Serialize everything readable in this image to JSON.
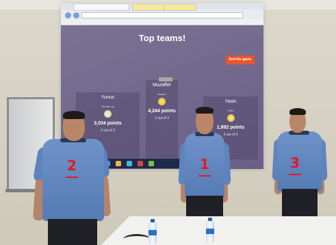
{
  "screen": {
    "title": "Top teams!",
    "end_button": "End the game",
    "url": "",
    "teams": [
      {
        "rank_number": "1",
        "name": "Muzaffer",
        "points": "4,244 points",
        "rank_text": "1 out of 3",
        "label": "Winner"
      },
      {
        "rank_number": "2",
        "name": "Yunus",
        "points": "3,034 points",
        "rank_text": "2 out of 3",
        "label": "Runner up"
      },
      {
        "rank_number": "3",
        "name": "Yasin",
        "points": "1,892 points",
        "rank_text": "3 out of 3",
        "label": "Third"
      }
    ]
  },
  "overlay_labels": {
    "left_person": "2",
    "center_person": "1",
    "right_person": "3"
  },
  "colors": {
    "screen_bg": "#6f6590",
    "accent_orange": "#e8562b",
    "label_red": "#e21a1a",
    "shirt_blue": "#5f84bd"
  }
}
